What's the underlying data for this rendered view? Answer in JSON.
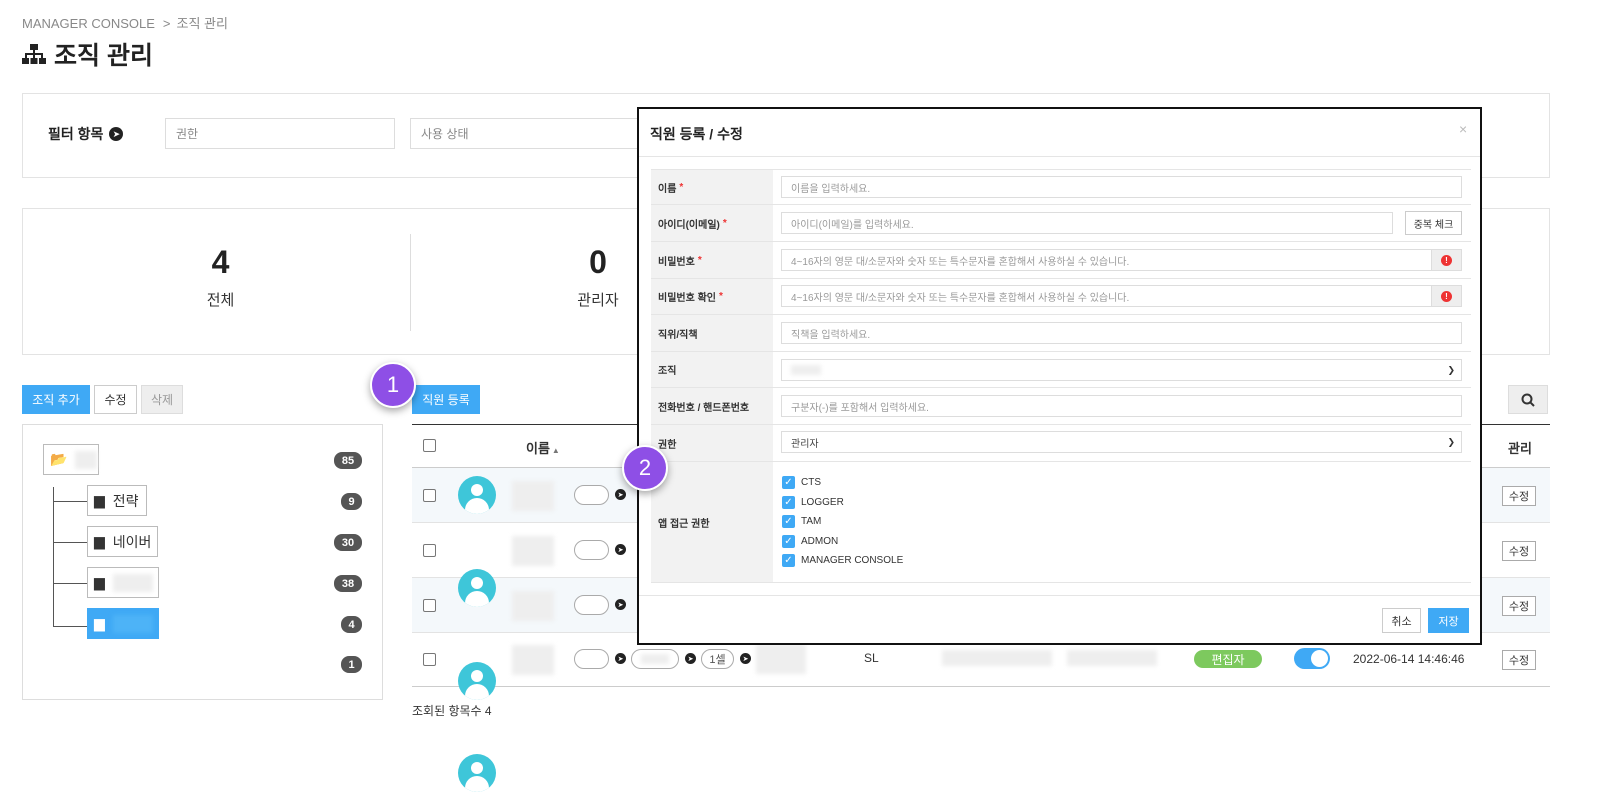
{
  "breadcrumb": {
    "root": "MANAGER CONSOLE",
    "separator": ">",
    "current": "조직 관리"
  },
  "page_title": "조직 관리",
  "page_icon": "sitemap-icon",
  "filter": {
    "label": "필터 항목",
    "authority_placeholder": "권한",
    "status_placeholder": "사용 상태"
  },
  "stats": [
    {
      "value": "4",
      "label": "전체"
    },
    {
      "value": "0",
      "label": "관리자"
    }
  ],
  "org_toolbar": {
    "add": "조직 추가",
    "edit": "수정",
    "delete": "삭제"
  },
  "register_button": "직원 등록",
  "tree": {
    "root_count": "85",
    "children": [
      {
        "label": "전략",
        "count": "9"
      },
      {
        "label": "네이버",
        "count": "30"
      },
      {
        "label": "",
        "count": "38"
      },
      {
        "label": "",
        "count": "4"
      }
    ],
    "extra_count": "1"
  },
  "table": {
    "col_name": "이름",
    "sort_icon": "▲",
    "col_manage": "관리",
    "edit_label": "수정",
    "last_row": {
      "position": "SL",
      "role_badge": "편집자",
      "timestamp": "2022-06-14 14:46:46",
      "pill_text": "1셀"
    }
  },
  "result_count": "조회된 항목수 4",
  "markers": [
    "1",
    "2"
  ],
  "modal": {
    "title": "직원 등록 / 수정",
    "close": "×",
    "fields": {
      "name": {
        "label": "이름",
        "required": "*",
        "placeholder": "이름을 입력하세요."
      },
      "id": {
        "label": "아이디(이메일)",
        "required": "*",
        "placeholder": "아이디(이메일)를 입력하세요.",
        "button": "중복 체크"
      },
      "password": {
        "label": "비밀번호",
        "required": "*",
        "placeholder": "4~16자의 영문 대/소문자와 숫자 또는 특수문자를 혼합해서 사용하실 수 있습니다."
      },
      "password_confirm": {
        "label": "비밀번호 확인",
        "required": "*",
        "placeholder": "4~16자의 영문 대/소문자와 숫자 또는 특수문자를 혼합해서 사용하실 수 있습니다."
      },
      "position": {
        "label": "직위/직책",
        "placeholder": "직책을 입력하세요."
      },
      "org": {
        "label": "조직"
      },
      "phone": {
        "label": "전화번호 / 핸드폰번호",
        "placeholder": "구분자(-)를 포함해서 입력하세요."
      },
      "authority": {
        "label": "권한",
        "value": "관리자"
      },
      "apps": {
        "label": "앱 접근 권한",
        "options": [
          "CTS",
          "LOGGER",
          "TAM",
          "ADMON",
          "MANAGER CONSOLE"
        ]
      }
    },
    "cancel": "취소",
    "save": "저장"
  },
  "colors": {
    "accent": "#3fa9f5",
    "marker": "#8e4fe6",
    "badge_green": "#7dc95e",
    "avatar": "#3ec6d9"
  }
}
